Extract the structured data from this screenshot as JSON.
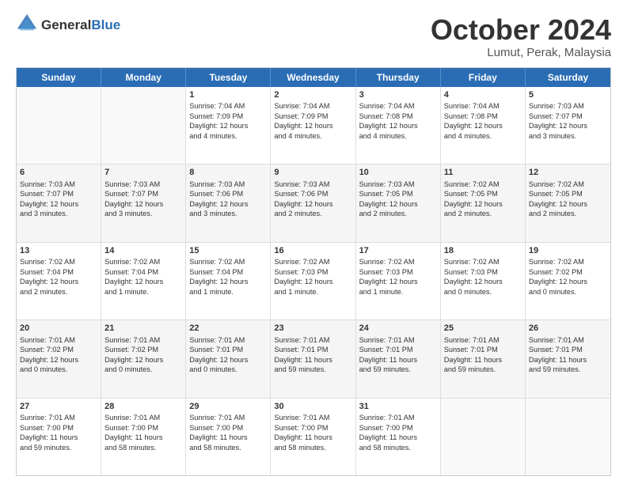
{
  "header": {
    "logo_line1": "General",
    "logo_line2": "Blue",
    "month": "October 2024",
    "location": "Lumut, Perak, Malaysia"
  },
  "days_of_week": [
    "Sunday",
    "Monday",
    "Tuesday",
    "Wednesday",
    "Thursday",
    "Friday",
    "Saturday"
  ],
  "rows": [
    [
      {
        "day": "",
        "info": ""
      },
      {
        "day": "",
        "info": ""
      },
      {
        "day": "1",
        "info": "Sunrise: 7:04 AM\nSunset: 7:09 PM\nDaylight: 12 hours\nand 4 minutes."
      },
      {
        "day": "2",
        "info": "Sunrise: 7:04 AM\nSunset: 7:09 PM\nDaylight: 12 hours\nand 4 minutes."
      },
      {
        "day": "3",
        "info": "Sunrise: 7:04 AM\nSunset: 7:08 PM\nDaylight: 12 hours\nand 4 minutes."
      },
      {
        "day": "4",
        "info": "Sunrise: 7:04 AM\nSunset: 7:08 PM\nDaylight: 12 hours\nand 4 minutes."
      },
      {
        "day": "5",
        "info": "Sunrise: 7:03 AM\nSunset: 7:07 PM\nDaylight: 12 hours\nand 3 minutes."
      }
    ],
    [
      {
        "day": "6",
        "info": "Sunrise: 7:03 AM\nSunset: 7:07 PM\nDaylight: 12 hours\nand 3 minutes."
      },
      {
        "day": "7",
        "info": "Sunrise: 7:03 AM\nSunset: 7:07 PM\nDaylight: 12 hours\nand 3 minutes."
      },
      {
        "day": "8",
        "info": "Sunrise: 7:03 AM\nSunset: 7:06 PM\nDaylight: 12 hours\nand 3 minutes."
      },
      {
        "day": "9",
        "info": "Sunrise: 7:03 AM\nSunset: 7:06 PM\nDaylight: 12 hours\nand 2 minutes."
      },
      {
        "day": "10",
        "info": "Sunrise: 7:03 AM\nSunset: 7:05 PM\nDaylight: 12 hours\nand 2 minutes."
      },
      {
        "day": "11",
        "info": "Sunrise: 7:02 AM\nSunset: 7:05 PM\nDaylight: 12 hours\nand 2 minutes."
      },
      {
        "day": "12",
        "info": "Sunrise: 7:02 AM\nSunset: 7:05 PM\nDaylight: 12 hours\nand 2 minutes."
      }
    ],
    [
      {
        "day": "13",
        "info": "Sunrise: 7:02 AM\nSunset: 7:04 PM\nDaylight: 12 hours\nand 2 minutes."
      },
      {
        "day": "14",
        "info": "Sunrise: 7:02 AM\nSunset: 7:04 PM\nDaylight: 12 hours\nand 1 minute."
      },
      {
        "day": "15",
        "info": "Sunrise: 7:02 AM\nSunset: 7:04 PM\nDaylight: 12 hours\nand 1 minute."
      },
      {
        "day": "16",
        "info": "Sunrise: 7:02 AM\nSunset: 7:03 PM\nDaylight: 12 hours\nand 1 minute."
      },
      {
        "day": "17",
        "info": "Sunrise: 7:02 AM\nSunset: 7:03 PM\nDaylight: 12 hours\nand 1 minute."
      },
      {
        "day": "18",
        "info": "Sunrise: 7:02 AM\nSunset: 7:03 PM\nDaylight: 12 hours\nand 0 minutes."
      },
      {
        "day": "19",
        "info": "Sunrise: 7:02 AM\nSunset: 7:02 PM\nDaylight: 12 hours\nand 0 minutes."
      }
    ],
    [
      {
        "day": "20",
        "info": "Sunrise: 7:01 AM\nSunset: 7:02 PM\nDaylight: 12 hours\nand 0 minutes."
      },
      {
        "day": "21",
        "info": "Sunrise: 7:01 AM\nSunset: 7:02 PM\nDaylight: 12 hours\nand 0 minutes."
      },
      {
        "day": "22",
        "info": "Sunrise: 7:01 AM\nSunset: 7:01 PM\nDaylight: 12 hours\nand 0 minutes."
      },
      {
        "day": "23",
        "info": "Sunrise: 7:01 AM\nSunset: 7:01 PM\nDaylight: 11 hours\nand 59 minutes."
      },
      {
        "day": "24",
        "info": "Sunrise: 7:01 AM\nSunset: 7:01 PM\nDaylight: 11 hours\nand 59 minutes."
      },
      {
        "day": "25",
        "info": "Sunrise: 7:01 AM\nSunset: 7:01 PM\nDaylight: 11 hours\nand 59 minutes."
      },
      {
        "day": "26",
        "info": "Sunrise: 7:01 AM\nSunset: 7:01 PM\nDaylight: 11 hours\nand 59 minutes."
      }
    ],
    [
      {
        "day": "27",
        "info": "Sunrise: 7:01 AM\nSunset: 7:00 PM\nDaylight: 11 hours\nand 59 minutes."
      },
      {
        "day": "28",
        "info": "Sunrise: 7:01 AM\nSunset: 7:00 PM\nDaylight: 11 hours\nand 58 minutes."
      },
      {
        "day": "29",
        "info": "Sunrise: 7:01 AM\nSunset: 7:00 PM\nDaylight: 11 hours\nand 58 minutes."
      },
      {
        "day": "30",
        "info": "Sunrise: 7:01 AM\nSunset: 7:00 PM\nDaylight: 11 hours\nand 58 minutes."
      },
      {
        "day": "31",
        "info": "Sunrise: 7:01 AM\nSunset: 7:00 PM\nDaylight: 11 hours\nand 58 minutes."
      },
      {
        "day": "",
        "info": ""
      },
      {
        "day": "",
        "info": ""
      }
    ]
  ]
}
